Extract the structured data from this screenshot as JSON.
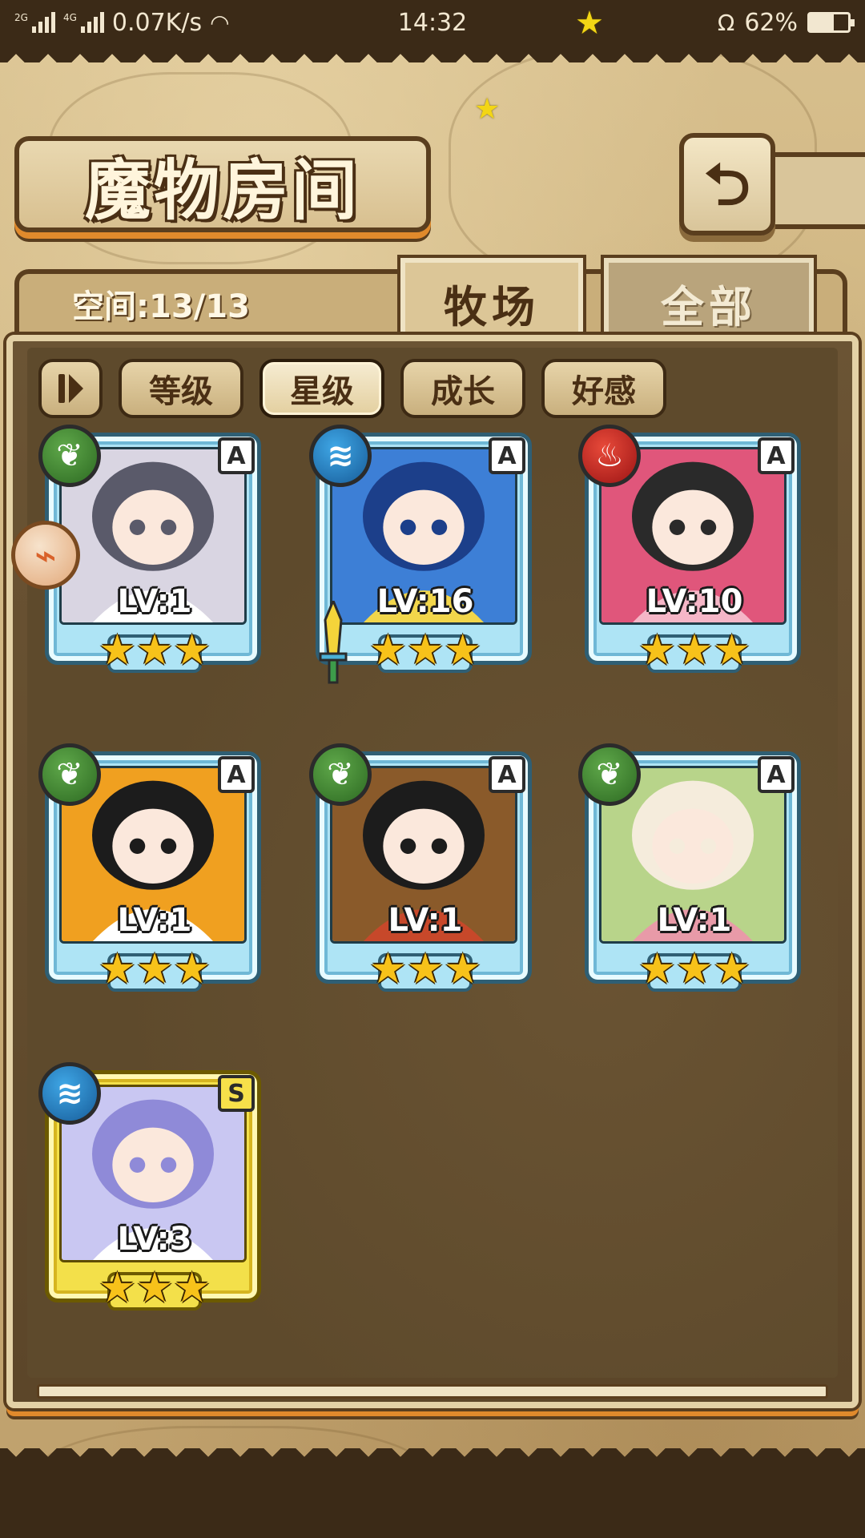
{
  "status_bar": {
    "network_2g": "2G",
    "network_4g": "4G",
    "speed": "0.07K/s",
    "time": "14:32",
    "battery": "62%",
    "battery_level": 0.62
  },
  "header": {
    "title": "魔物房间",
    "back_icon": "return-arrow-icon"
  },
  "capacity": {
    "label": "空间:13/13"
  },
  "tabs": [
    {
      "label": "牧场",
      "active": true
    },
    {
      "label": "全部",
      "active": false
    }
  ],
  "sort": {
    "buttons": [
      {
        "label": "等级",
        "selected": false
      },
      {
        "label": "星级",
        "selected": true
      },
      {
        "label": "成长",
        "selected": false
      },
      {
        "label": "好感",
        "selected": false
      }
    ]
  },
  "monsters": [
    {
      "element": "leaf",
      "rank": "A",
      "level": "LV:1",
      "stars": 3,
      "frame": "blue",
      "palette": [
        "#d9d5e2",
        "#5a5a6a",
        "#ffffff"
      ]
    },
    {
      "element": "water",
      "rank": "A",
      "level": "LV:16",
      "stars": 3,
      "frame": "blue",
      "palette": [
        "#3d7fd6",
        "#1c3f8a",
        "#f2d64b"
      ]
    },
    {
      "element": "fire",
      "rank": "A",
      "level": "LV:10",
      "stars": 3,
      "frame": "blue",
      "palette": [
        "#e0567b",
        "#2a2a2a",
        "#f5b6c7"
      ]
    },
    {
      "element": "leaf",
      "rank": "A",
      "level": "LV:1",
      "stars": 3,
      "frame": "blue",
      "palette": [
        "#f0a020",
        "#1c1c1c",
        "#ffffff"
      ]
    },
    {
      "element": "leaf",
      "rank": "A",
      "level": "LV:1",
      "stars": 3,
      "frame": "blue",
      "palette": [
        "#8a5a2a",
        "#1c1c1c",
        "#c7482a"
      ]
    },
    {
      "element": "leaf",
      "rank": "A",
      "level": "LV:1",
      "stars": 3,
      "frame": "blue",
      "palette": [
        "#b8d48a",
        "#f5ecdc",
        "#e89aa8"
      ]
    },
    {
      "element": "water",
      "rank": "S",
      "level": "LV:3",
      "stars": 3,
      "frame": "gold",
      "palette": [
        "#c9c7f2",
        "#8f8ad8",
        "#ffffff"
      ]
    }
  ],
  "icons": {
    "leaf": "leaf-element-icon",
    "water": "water-element-icon",
    "fire": "fire-element-icon",
    "side_tag": "lock-tag-icon",
    "equip": "sword-equip-icon"
  },
  "colors": {
    "frame_blue": "#aee4f5",
    "frame_gold": "#f3e04a",
    "star": "#f7c21a",
    "accent_orange": "#e08a2c"
  }
}
